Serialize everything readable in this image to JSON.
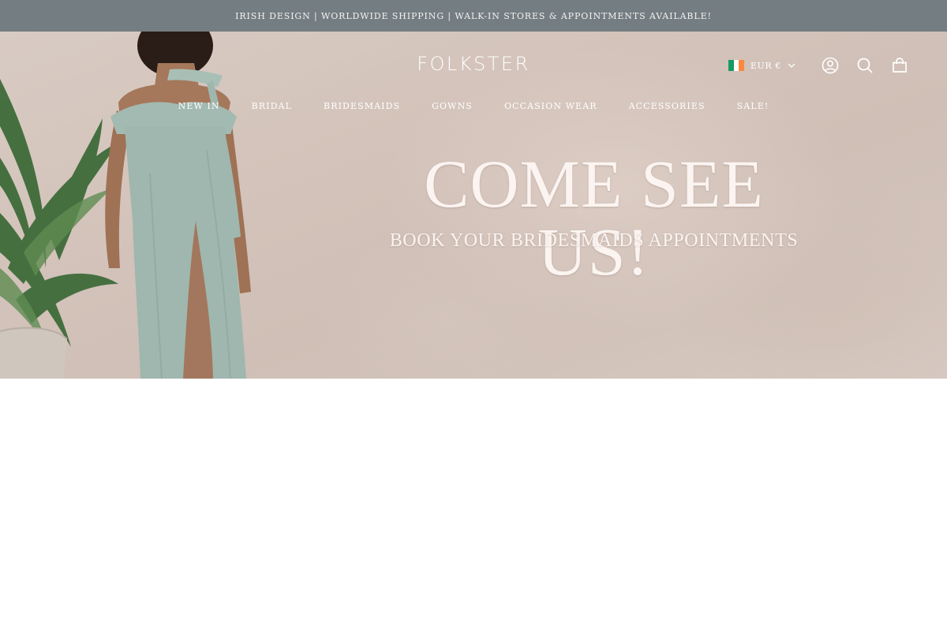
{
  "announcement": "IRISH DESIGN | WORLDWIDE SHIPPING | WALK-IN STORES & APPOINTMENTS AVAILABLE!",
  "header": {
    "logo": "FOLKSTER",
    "currency": "EUR €",
    "icons": [
      "flag-icon",
      "chevron-down-icon",
      "account-icon",
      "search-icon",
      "bag-icon"
    ]
  },
  "nav": {
    "items": [
      "NEW IN",
      "BRIDAL",
      "BRIDESMAIDS",
      "GOWNS",
      "OCCASION WEAR",
      "ACCESSORIES",
      "SALE!"
    ]
  },
  "hero": {
    "headline": "COME SEE US!",
    "subline": "BOOK YOUR BRIDESMAIDS APPOINTMENTS"
  },
  "colors": {
    "announcement_bg": "#747d81",
    "hero_bg": "#d3c3ba",
    "dress": "#9fb7ae",
    "flag_green": "#169b62",
    "flag_white": "#ffffff",
    "flag_orange": "#ff883e"
  }
}
